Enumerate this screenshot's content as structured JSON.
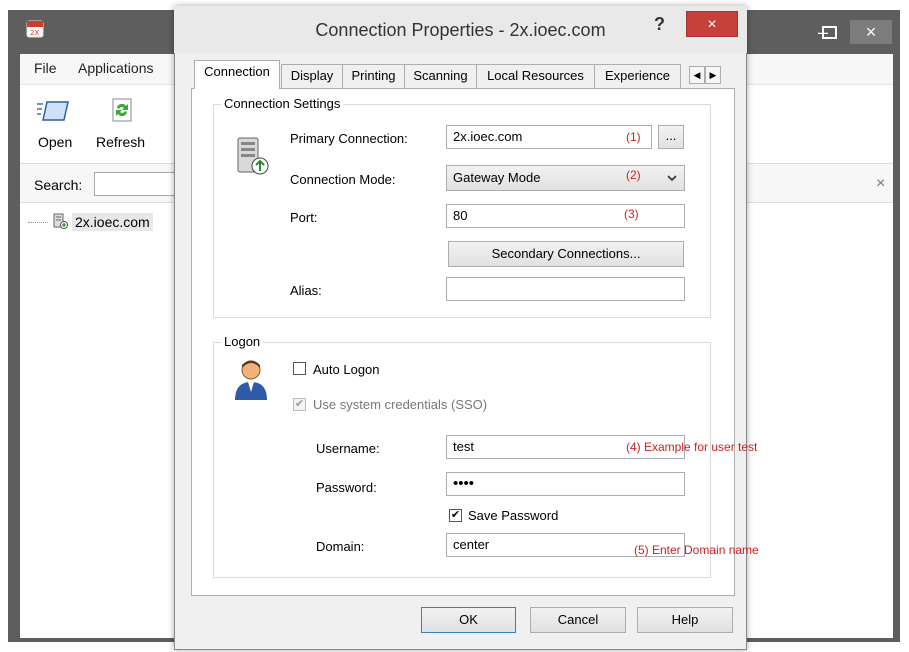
{
  "main_window": {
    "menu": [
      "File",
      "Applications"
    ],
    "toolbar": {
      "open_label": "Open",
      "refresh_label": "Refresh"
    },
    "search_label": "Search:",
    "search_value": "",
    "tree_item": "2x.ioec.com",
    "close_glyph": "×"
  },
  "dialog": {
    "title": "Connection Properties - 2x.ioec.com",
    "help_glyph": "?",
    "close_glyph": "×",
    "tabs": [
      "Connection",
      "Display",
      "Printing",
      "Scanning",
      "Local Resources",
      "Experience"
    ],
    "active_tab": "Connection",
    "connection_settings": {
      "group_title": "Connection Settings",
      "primary_label": "Primary Connection:",
      "primary_value": "2x.ioec.com",
      "primary_annotation": "(1)",
      "browse_label": "...",
      "mode_label": "Connection Mode:",
      "mode_value": "Gateway Mode",
      "mode_annotation": "(2)",
      "port_label": "Port:",
      "port_value": "80",
      "port_annotation": "(3)",
      "secondary_button": "Secondary Connections...",
      "alias_label": "Alias:",
      "alias_value": ""
    },
    "logon": {
      "group_title": "Logon",
      "auto_logon_label": "Auto Logon",
      "auto_logon_checked": false,
      "sso_label": "Use system credentials (SSO)",
      "sso_checked": true,
      "username_label": "Username:",
      "username_value": "test",
      "username_annotation": "(4) Example for user test",
      "password_label": "Password:",
      "password_value": "••••",
      "save_password_label": "Save Password",
      "save_password_checked": true,
      "domain_label": "Domain:",
      "domain_value": "center",
      "domain_annotation": "(5) Enter Domain name"
    },
    "buttons": {
      "ok": "OK",
      "cancel": "Cancel",
      "help": "Help"
    }
  },
  "colors": {
    "close_red": "#c7413b",
    "annotation_red": "#d02020",
    "window_frame": "#5e5e5e"
  }
}
